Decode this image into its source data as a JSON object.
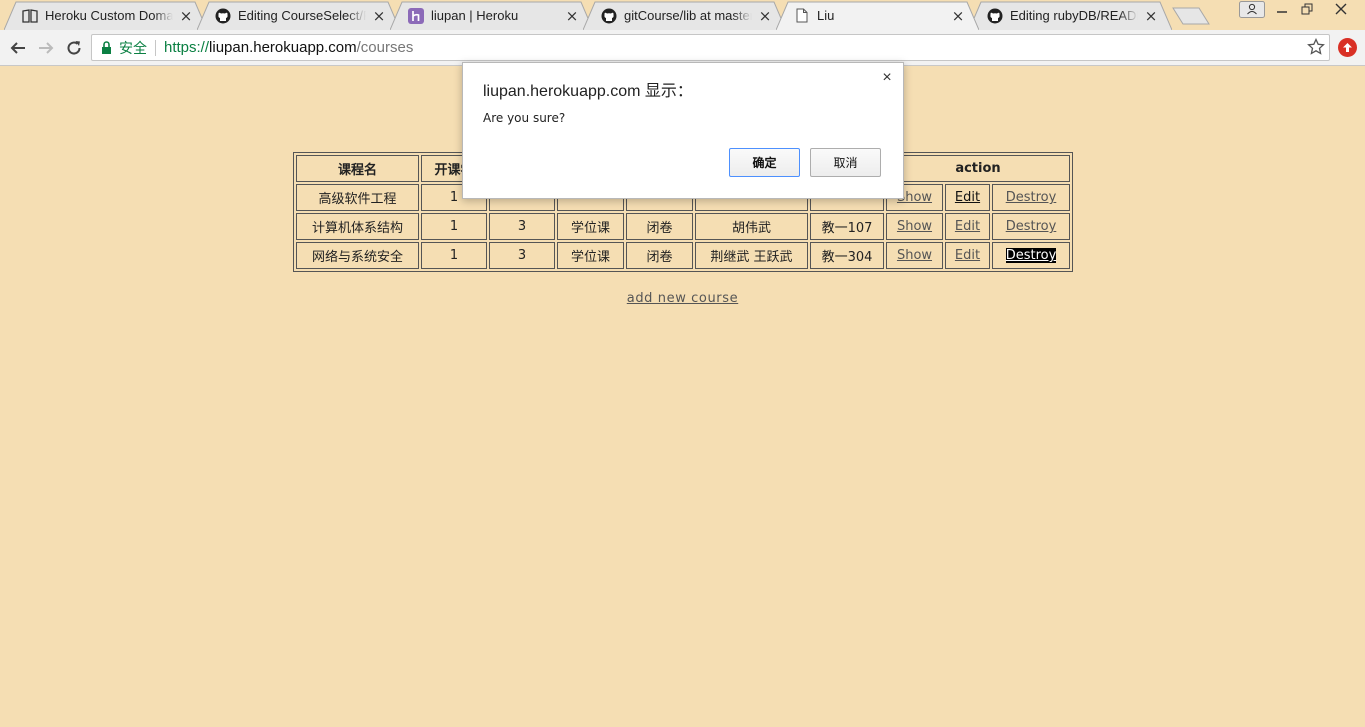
{
  "browser": {
    "tabs": [
      {
        "title": "Heroku Custom Domai",
        "icon": "book-icon",
        "active": false
      },
      {
        "title": "Editing CourseSelect/R",
        "icon": "github-icon",
        "active": false
      },
      {
        "title": "liupan | Heroku",
        "icon": "heroku-icon",
        "active": false
      },
      {
        "title": "gitCourse/lib at master",
        "icon": "github-icon",
        "active": false
      },
      {
        "title": "Liu",
        "icon": "page-icon",
        "active": true
      },
      {
        "title": "Editing rubyDB/READM",
        "icon": "github-icon",
        "active": false
      }
    ],
    "secure_label": "安全",
    "url": {
      "scheme": "https://",
      "host": "liupan.herokuapp.com",
      "path": "/courses"
    }
  },
  "table": {
    "headers": {
      "course_name": "课程名",
      "semester": "开课学",
      "action": "action"
    },
    "rows": [
      {
        "name": "高级软件工程",
        "semester": "1",
        "credit": "",
        "type": "",
        "exam": "",
        "teacher": "",
        "room": "",
        "show": "Show",
        "edit": "Edit",
        "destroy": "Destroy"
      },
      {
        "name": "计算机体系结构",
        "semester": "1",
        "credit": "3",
        "type": "学位课",
        "exam": "闭卷",
        "teacher": "胡伟武",
        "room": "教一107",
        "show": "Show",
        "edit": "Edit",
        "destroy": "Destroy"
      },
      {
        "name": "网络与系统安全",
        "semester": "1",
        "credit": "3",
        "type": "学位课",
        "exam": "闭卷",
        "teacher": "荆继武 王跃武",
        "room": "教一304",
        "show": "Show",
        "edit": "Edit",
        "destroy": "Destroy"
      }
    ]
  },
  "add_link": "add new course",
  "dialog": {
    "title": "liupan.herokuapp.com 显示：",
    "message": "Are you sure?",
    "ok_label": "确定",
    "cancel_label": "取消"
  },
  "colors": {
    "page_background": "#f5deb3",
    "secure_green": "#0b8043",
    "dialog_focus_border": "#4d90fe"
  }
}
